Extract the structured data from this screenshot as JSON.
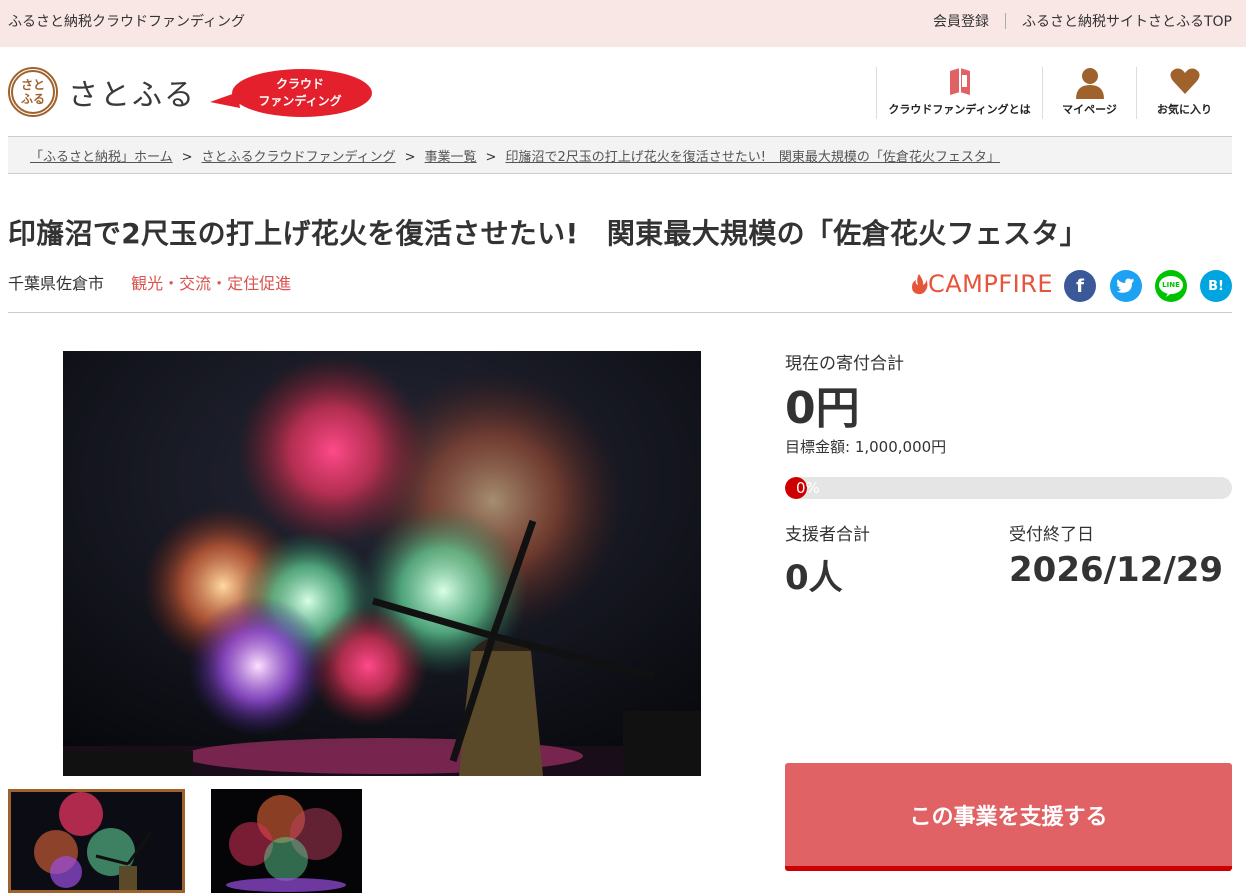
{
  "topbar": {
    "site_name": "ふるさと納税クラウドファンディング",
    "register": "会員登録",
    "satofull_top": "ふるさと納税サイトさとふるTOP"
  },
  "header": {
    "logo_mark": "さと",
    "logo_text": "さとふる",
    "cf_badge_line1": "クラウド",
    "cf_badge_line2": "ファンディング",
    "nav": [
      {
        "label": "クラウドファンディングとは",
        "icon": "book-icon"
      },
      {
        "label": "マイページ",
        "icon": "user-icon"
      },
      {
        "label": "お気に入り",
        "icon": "heart-icon"
      }
    ]
  },
  "breadcrumb": [
    "「ふるさと納税」ホーム",
    "さとふるクラウドファンディング",
    "事業一覧",
    "印旛沼で2尺玉の打上げ花火を復活させたい!　関東最大規模の「佐倉花火フェスタ」"
  ],
  "breadcrumb_sep": ">",
  "project": {
    "title": "印旛沼で2尺玉の打上げ花火を復活させたい!　関東最大規模の「佐倉花火フェスタ」",
    "city": "千葉県佐倉市",
    "category": "観光・交流・定住促進",
    "partner": "CAMPFIRE"
  },
  "social": {
    "facebook": "f",
    "twitter": "t",
    "line": "LINE",
    "hatena": "B!"
  },
  "stats": {
    "current_label": "現在の寄付合計",
    "current_amount": "0円",
    "goal": "目標金額: 1,000,000円",
    "progress_text": "0%",
    "progress": 0,
    "supporters_label": "支援者合計",
    "supporters": "0人",
    "deadline_label": "受付終了日",
    "deadline": "2026/12/29"
  },
  "support_button": "この事業を支援する",
  "colors": {
    "accent": "#e06265",
    "brand_brown": "#a0622d",
    "tag_red": "#d9534f",
    "topbar_bg": "#f9e7e5"
  }
}
